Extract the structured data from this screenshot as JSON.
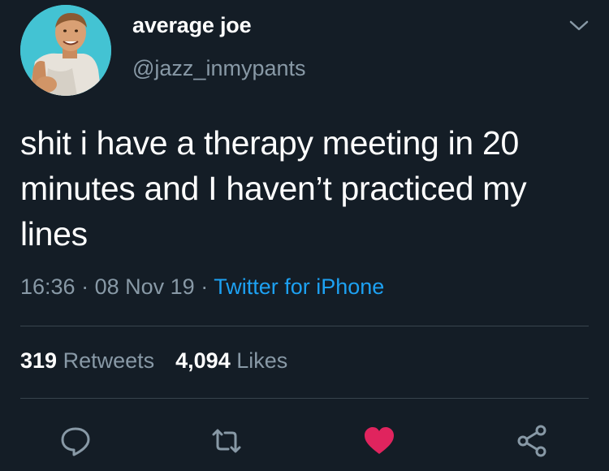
{
  "user": {
    "display_name": "average joe",
    "handle": "@jazz_inmypants",
    "avatar_icon": "profile-photo"
  },
  "tweet": {
    "text": "shit i have a therapy meeting in 20 minutes and I haven’t practiced my lines",
    "time": "16:36",
    "date": "08 Nov 19",
    "separator": "·",
    "source": "Twitter for iPhone"
  },
  "stats": {
    "retweets_count": "319",
    "retweets_label": "Retweets",
    "likes_count": "4,094",
    "likes_label": "Likes"
  },
  "actions": [
    {
      "name": "reply",
      "icon": "speech-bubble-icon"
    },
    {
      "name": "retweet",
      "icon": "retweet-arrows-icon"
    },
    {
      "name": "like",
      "icon": "heart-icon",
      "active": true
    },
    {
      "name": "share",
      "icon": "share-nodes-icon"
    }
  ],
  "colors": {
    "background": "#141d26",
    "text_primary": "#ffffff",
    "text_secondary": "#8899a6",
    "link": "#1da1f2",
    "like_active": "#e0245e",
    "divider": "#38444d",
    "avatar_bg": "#43c3d3"
  }
}
